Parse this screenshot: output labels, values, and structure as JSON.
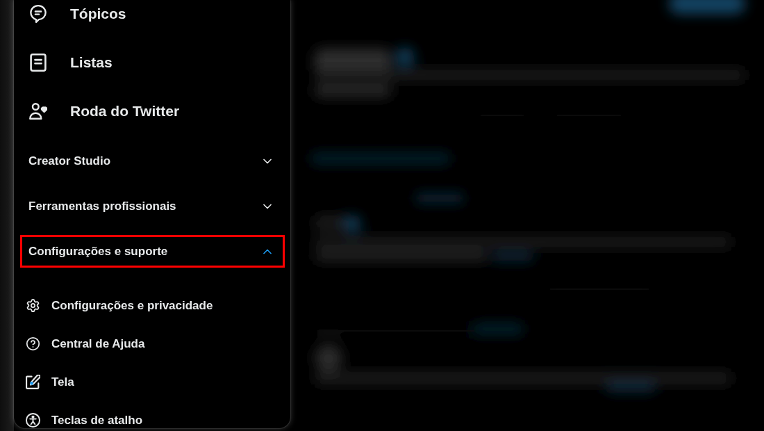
{
  "menu": {
    "items": [
      {
        "label": "Tópicos"
      },
      {
        "label": "Listas"
      },
      {
        "label": "Roda do Twitter"
      }
    ]
  },
  "sections": [
    {
      "label": "Creator Studio",
      "expanded": false,
      "highlighted": false
    },
    {
      "label": "Ferramentas profissionais",
      "expanded": false,
      "highlighted": false
    },
    {
      "label": "Configurações e suporte",
      "expanded": true,
      "highlighted": true,
      "children": [
        {
          "label": "Configurações e privacidade"
        },
        {
          "label": "Central de Ajuda"
        },
        {
          "label": "Tela"
        },
        {
          "label": "Teclas de atalho"
        }
      ]
    }
  ]
}
